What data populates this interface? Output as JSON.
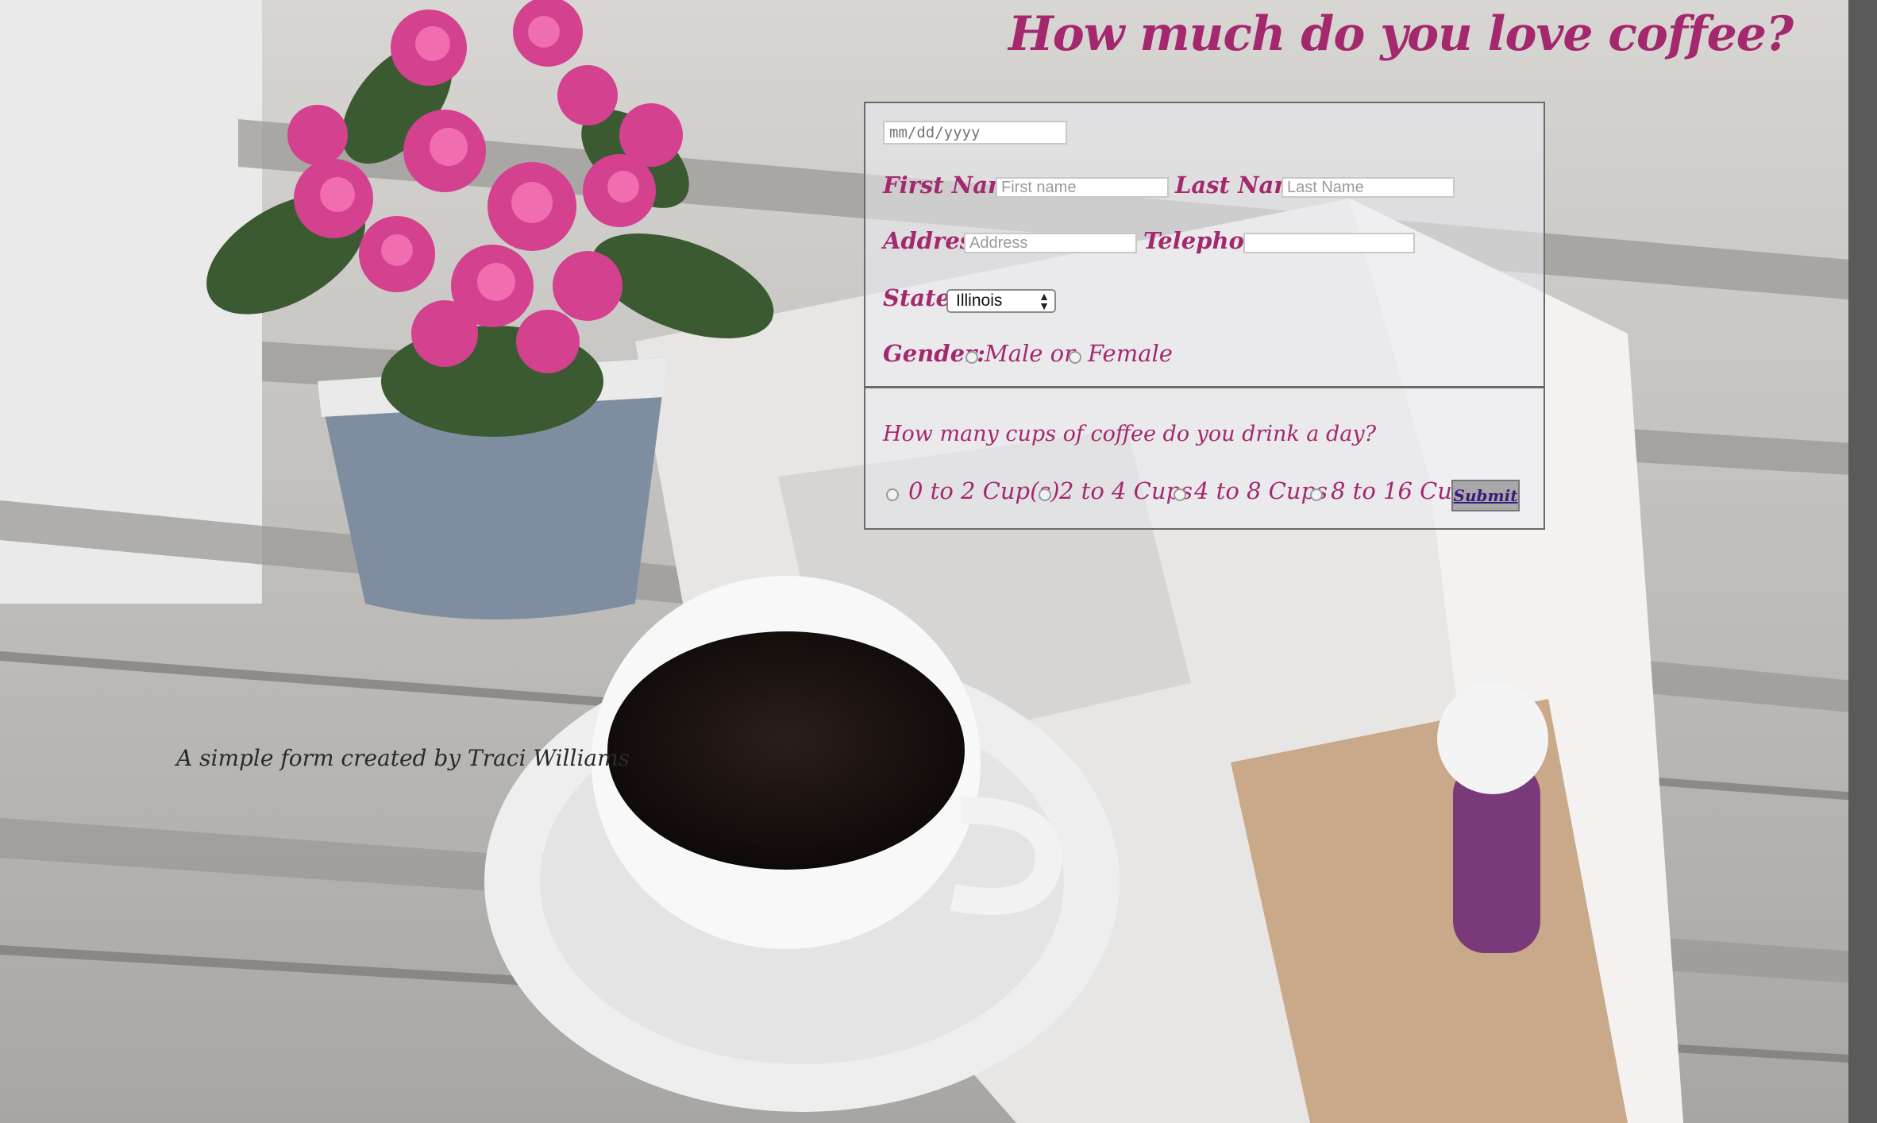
{
  "page": {
    "title": "How much do you love coffee?",
    "credit": "A simple form created by Traci Williams"
  },
  "form": {
    "date_placeholder": "mm/dd/yyyy",
    "first_name": {
      "label": "First Name:",
      "placeholder": "First name"
    },
    "last_name": {
      "label": "Last Name:",
      "placeholder": "Last Name"
    },
    "address": {
      "label": "Address:",
      "placeholder": "Address"
    },
    "telephone": {
      "label": "Telephone:",
      "placeholder": ""
    },
    "state": {
      "label": "State:",
      "selected": "Illinois"
    },
    "gender": {
      "label": "Gender:",
      "options": [
        "Male or",
        "Female"
      ]
    },
    "cups": {
      "question": "How many cups of coffee do you drink a day?",
      "options": [
        "0 to 2 Cup(s)",
        "2 to 4 Cups",
        "4 to 8 Cups",
        "8 to 16 Cups"
      ]
    },
    "submit_label": "Submit"
  },
  "colors": {
    "accent": "#a4286e",
    "border": "#6a6a6a"
  }
}
